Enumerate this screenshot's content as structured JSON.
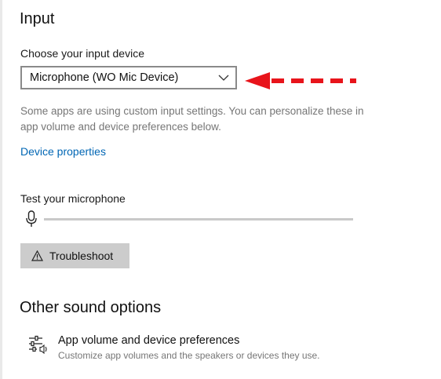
{
  "input_section": {
    "title": "Input",
    "choose_label": "Choose your input device",
    "device_dropdown": {
      "selected": "Microphone (WO Mic Device)",
      "icon": "chevron-down-icon"
    },
    "annotation": {
      "icon": "red-dashed-arrow",
      "color": "#e8141b"
    },
    "help_text": "Some apps are using custom input settings. You can personalize these in app volume and device preferences below.",
    "device_properties_link": "Device properties",
    "test_label": "Test your microphone",
    "mic_level": 0,
    "mic_icon": "microphone-icon",
    "troubleshoot": {
      "icon": "warning-icon",
      "label": "Troubleshoot"
    }
  },
  "other_section": {
    "title": "Other sound options",
    "app_volume": {
      "icon": "sliders-icon",
      "title": "App volume and device preferences",
      "description": "Customize app volumes and the speakers or devices they use."
    }
  },
  "colors": {
    "accent": "#0078d7",
    "link": "#0066b4",
    "secondary_text": "#767676",
    "button_bg": "#cccccc",
    "annotation_red": "#e8141b"
  }
}
